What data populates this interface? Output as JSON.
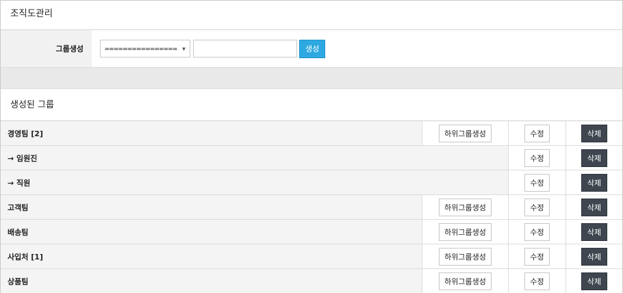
{
  "page_title": "조직도관리",
  "create": {
    "label": "그룹생성",
    "select_value": "================",
    "input_value": "",
    "button_label": "생성"
  },
  "section_title": "생성된 그룹",
  "buttons": {
    "sub_create": "하위그룹생성",
    "edit": "수정",
    "delete": "삭제"
  },
  "groups": [
    {
      "name": "경영팀 [2]",
      "has_sub_button": true
    },
    {
      "name": "→ 임원진",
      "has_sub_button": false
    },
    {
      "name": "→ 직원",
      "has_sub_button": false
    },
    {
      "name": "고객팀",
      "has_sub_button": true
    },
    {
      "name": "배송팀",
      "has_sub_button": true
    },
    {
      "name": "사입처 [1]",
      "has_sub_button": true
    },
    {
      "name": "상품팀",
      "has_sub_button": true
    }
  ]
}
